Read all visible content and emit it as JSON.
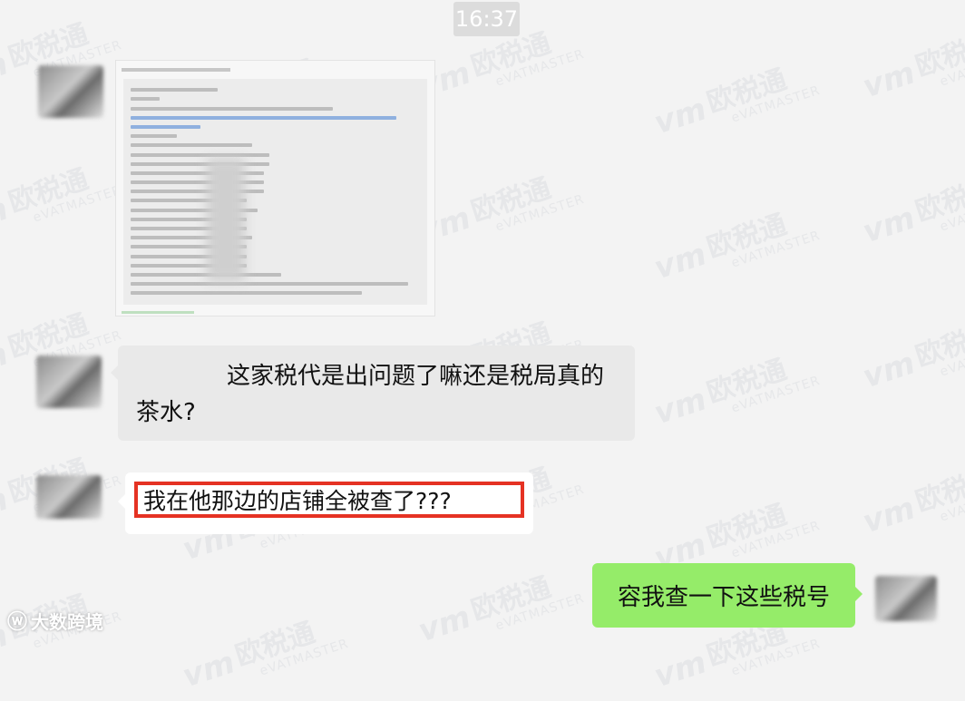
{
  "timestamp": "16:37",
  "messages": {
    "image_message": {
      "type": "image"
    },
    "question": "这家税代是出问题了嘛还是税局真的茶水?",
    "question_highlight": "我在他那边的店铺全被查了???",
    "reply": "容我查一下这些税号"
  },
  "watermark": {
    "cn": "欧税通",
    "en": "eVATMASTER"
  },
  "branding": {
    "label": "大数跨境",
    "icon": "weibo-icon"
  },
  "colors": {
    "background": "#f3f3f3",
    "incoming_bubble": "#e9e9e9",
    "outgoing_bubble": "#95ec69",
    "highlight_border": "#e53223"
  }
}
